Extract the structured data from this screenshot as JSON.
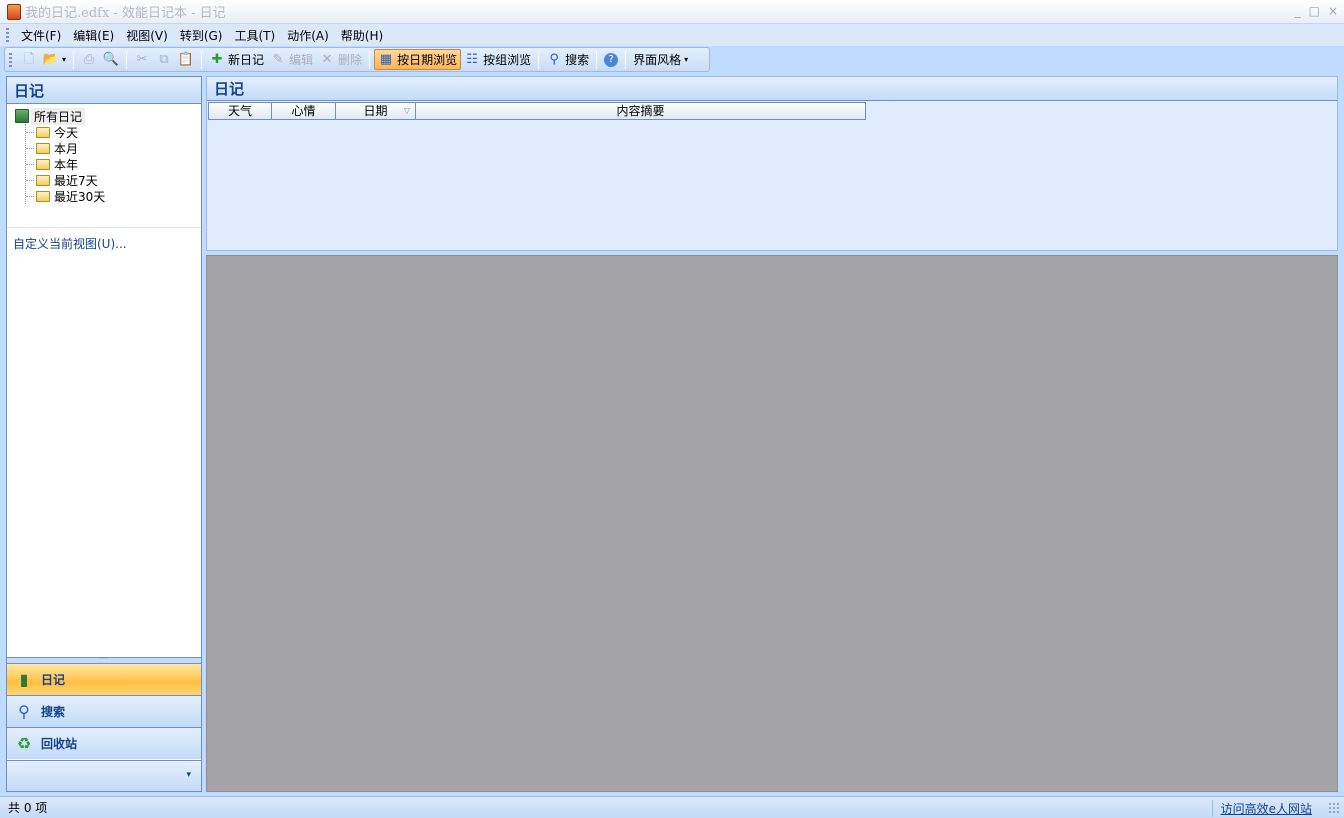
{
  "window": {
    "title": "我的日记.edfx - 效能日记本 - 日记",
    "controls": [
      "_",
      "□",
      "×"
    ]
  },
  "menu": [
    "文件(F)",
    "编辑(E)",
    "视图(V)",
    "转到(G)",
    "工具(T)",
    "动作(A)",
    "帮助(H)"
  ],
  "toolbar": {
    "new_diary": "新日记",
    "edit": "编辑",
    "delete": "删除",
    "browse_by_date": "按日期浏览",
    "browse_by_group": "按组浏览",
    "search": "搜索",
    "theme": "界面风格"
  },
  "left_pane": {
    "title": "日记",
    "tree_root": "所有日记",
    "tree_items": [
      "今天",
      "本月",
      "本年",
      "最近7天",
      "最近30天"
    ],
    "custom_view_link": "自定义当前视图(U)..."
  },
  "nav_buttons": [
    "日记",
    "搜索",
    "回收站"
  ],
  "main_pane": {
    "title": "日记",
    "columns": [
      "天气",
      "心情",
      "日期",
      "内容摘要"
    ]
  },
  "status": {
    "count_text": "共 0 项",
    "website_link": "访问高效e人网站"
  },
  "colors": {
    "accent": "#15428b",
    "selected_nav": "#ffc043",
    "content_gray": "#a4a3a8"
  }
}
